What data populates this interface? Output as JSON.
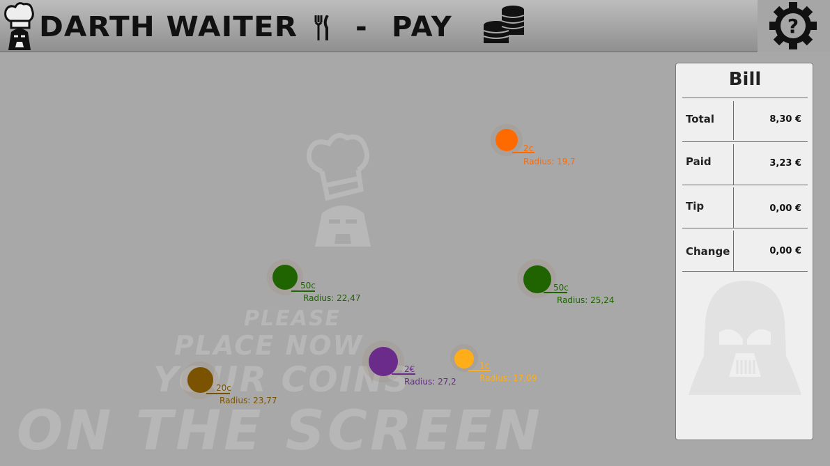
{
  "header": {
    "title": "DARTH WAITER",
    "separator": "-",
    "section": "PAY",
    "icons": [
      "vader-chef-logo-icon",
      "fork-knife-icon",
      "coin-stack-icon",
      "help-gear-icon"
    ]
  },
  "canvas": {
    "prompt_lines": [
      "PLEASE",
      "PLACE NOW",
      "YOUR COINS",
      "ON THE SCREEN"
    ],
    "coins": [
      {
        "label": "2c",
        "radius_text": "Radius: 19,7",
        "color": "#ff6a00"
      },
      {
        "label": "50c",
        "radius_text": "Radius: 22,47",
        "color": "#1f6400"
      },
      {
        "label": "50c",
        "radius_text": "Radius: 25,24",
        "color": "#1f6400"
      },
      {
        "label": "2€",
        "radius_text": "Radius: 27,2",
        "color": "#6a2b8a"
      },
      {
        "label": "1c",
        "radius_text": "Radius: 17,09",
        "color": "#ffae1a"
      },
      {
        "label": "20c",
        "radius_text": "Radius: 23,77",
        "color": "#7a5200"
      }
    ]
  },
  "bill": {
    "title": "Bill",
    "rows": [
      {
        "label": "Total",
        "value": "8,30 €"
      },
      {
        "label": "Paid",
        "value": "3,23 €"
      },
      {
        "label": "Tip",
        "value": "0,00 €"
      },
      {
        "label": "Change",
        "value": "0,00 €"
      }
    ]
  },
  "colors": {
    "accent_orange": "#ff6a00",
    "green": "#1f6400",
    "purple": "#6a2b8a",
    "yellow": "#ffae1a",
    "brown": "#7a5200"
  }
}
